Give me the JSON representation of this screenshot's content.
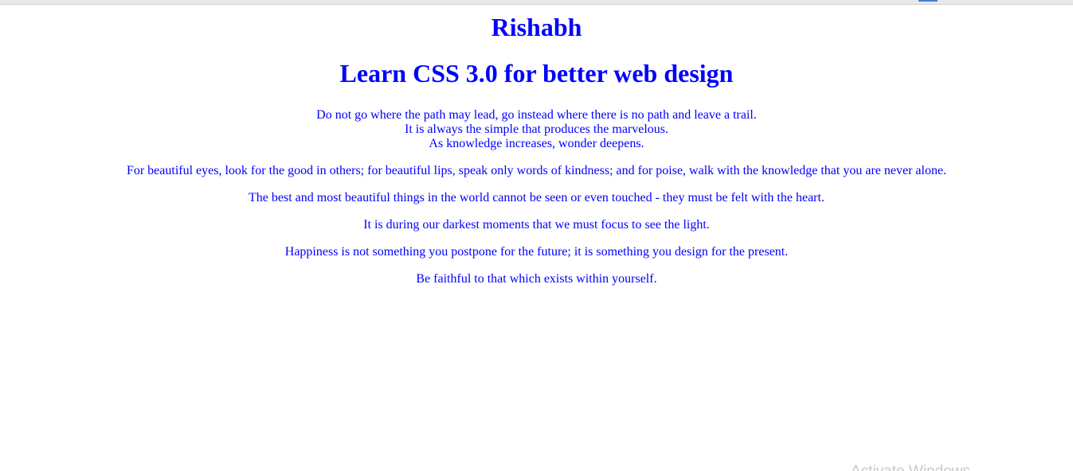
{
  "header": {
    "site_name": "Rishabh",
    "headline": "Learn CSS 3.0 for better web design"
  },
  "quotes": {
    "first_block": [
      "Do not go where the path may lead, go instead where there is no path and leave a trail.",
      "It is always the simple that produces the marvelous.",
      "As knowledge increases, wonder deepens."
    ],
    "paragraphs": [
      "For beautiful eyes, look for the good in others; for beautiful lips, speak only words of kindness; and for poise, walk with the knowledge that you are never alone.",
      "The best and most beautiful things in the world cannot be seen or even touched - they must be felt with the heart.",
      "It is during our darkest moments that we must focus to see the light.",
      "Happiness is not something you postpone for the future; it is something you design for the present.",
      "Be faithful to that which exists within yourself."
    ]
  },
  "overlay": {
    "watermark_text": "Activate Windows"
  },
  "colors": {
    "text": "#0000ff",
    "background": "#ffffff"
  }
}
